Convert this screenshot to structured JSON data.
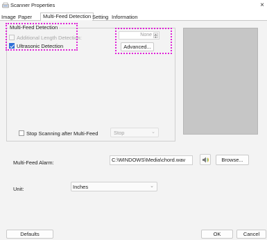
{
  "window": {
    "title": "Scanner Properties",
    "close_glyph": "×"
  },
  "tabs": [
    {
      "label": "Image",
      "active": false
    },
    {
      "label": "Paper",
      "active": false
    },
    {
      "label": "Multi-Feed Detection",
      "active": true
    },
    {
      "label": "Setting",
      "active": false
    },
    {
      "label": "Information",
      "active": false
    }
  ],
  "multifeed": {
    "group_title": "Multi-Feed Detection",
    "additional_length": {
      "label": "Additional Length Detection:",
      "checked": false,
      "enabled": false
    },
    "ultrasonic": {
      "label": "Ultrasonic Detection",
      "checked": true,
      "enabled": true
    },
    "length_value": "None",
    "advanced_label": "Advanced...",
    "stop_scanning": {
      "label": "Stop Scanning after Multi-Feed",
      "checked": false
    },
    "stop_select_value": "Stop"
  },
  "alarm": {
    "label": "Multi-Feed Alarm:",
    "path": "C:\\WINDOWS\\Media\\chord.wav",
    "sound_icon": "speaker-icon",
    "browse_label": "Browse..."
  },
  "unit": {
    "label": "Unit:",
    "value": "Inches"
  },
  "footer": {
    "defaults_label": "Defaults",
    "ok_label": "OK",
    "cancel_label": "Cancel"
  },
  "colors": {
    "accent": "#2f6fd8",
    "highlight_dotted": "#e020d8",
    "preview_gray": "#c6c6c6"
  }
}
